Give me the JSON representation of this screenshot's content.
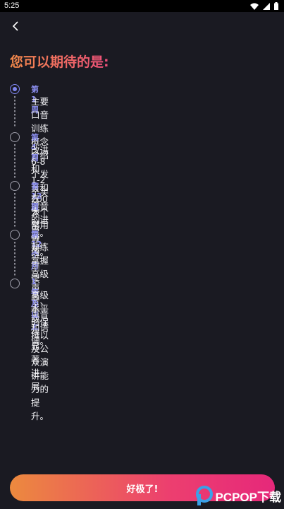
{
  "status_bar": {
    "time": "5:25"
  },
  "header": {
    "back_icon": "chevron-left-icon"
  },
  "title": "您可以期待的是:",
  "milestones": [
    {
      "period": "第 1 周",
      "text": "主要口音训练概念介绍和 1-2 个关键音的进展。",
      "active": true
    },
    {
      "period": "第 4 周",
      "text": "改进 6-8 个发音和 200 多个常用短语。",
      "active": false
    },
    {
      "period": "第 12 周",
      "text": "在大部分关键读音上取得显著进展",
      "active": false
    },
    {
      "period": "第 12 个月",
      "text": "熟练掌握高级声音、重音和语调。",
      "active": false
    },
    {
      "period": "1年及以上",
      "text": "高级水平的保持以及公众演讲能力的提升。",
      "active": false
    }
  ],
  "cta_label": "好极了!",
  "watermark": "PCPOP下载",
  "colors": {
    "accent": "#7f86f0",
    "gradient_start": "#ec8a3e",
    "gradient_end": "#e6287a",
    "background": "#1a1a22"
  }
}
